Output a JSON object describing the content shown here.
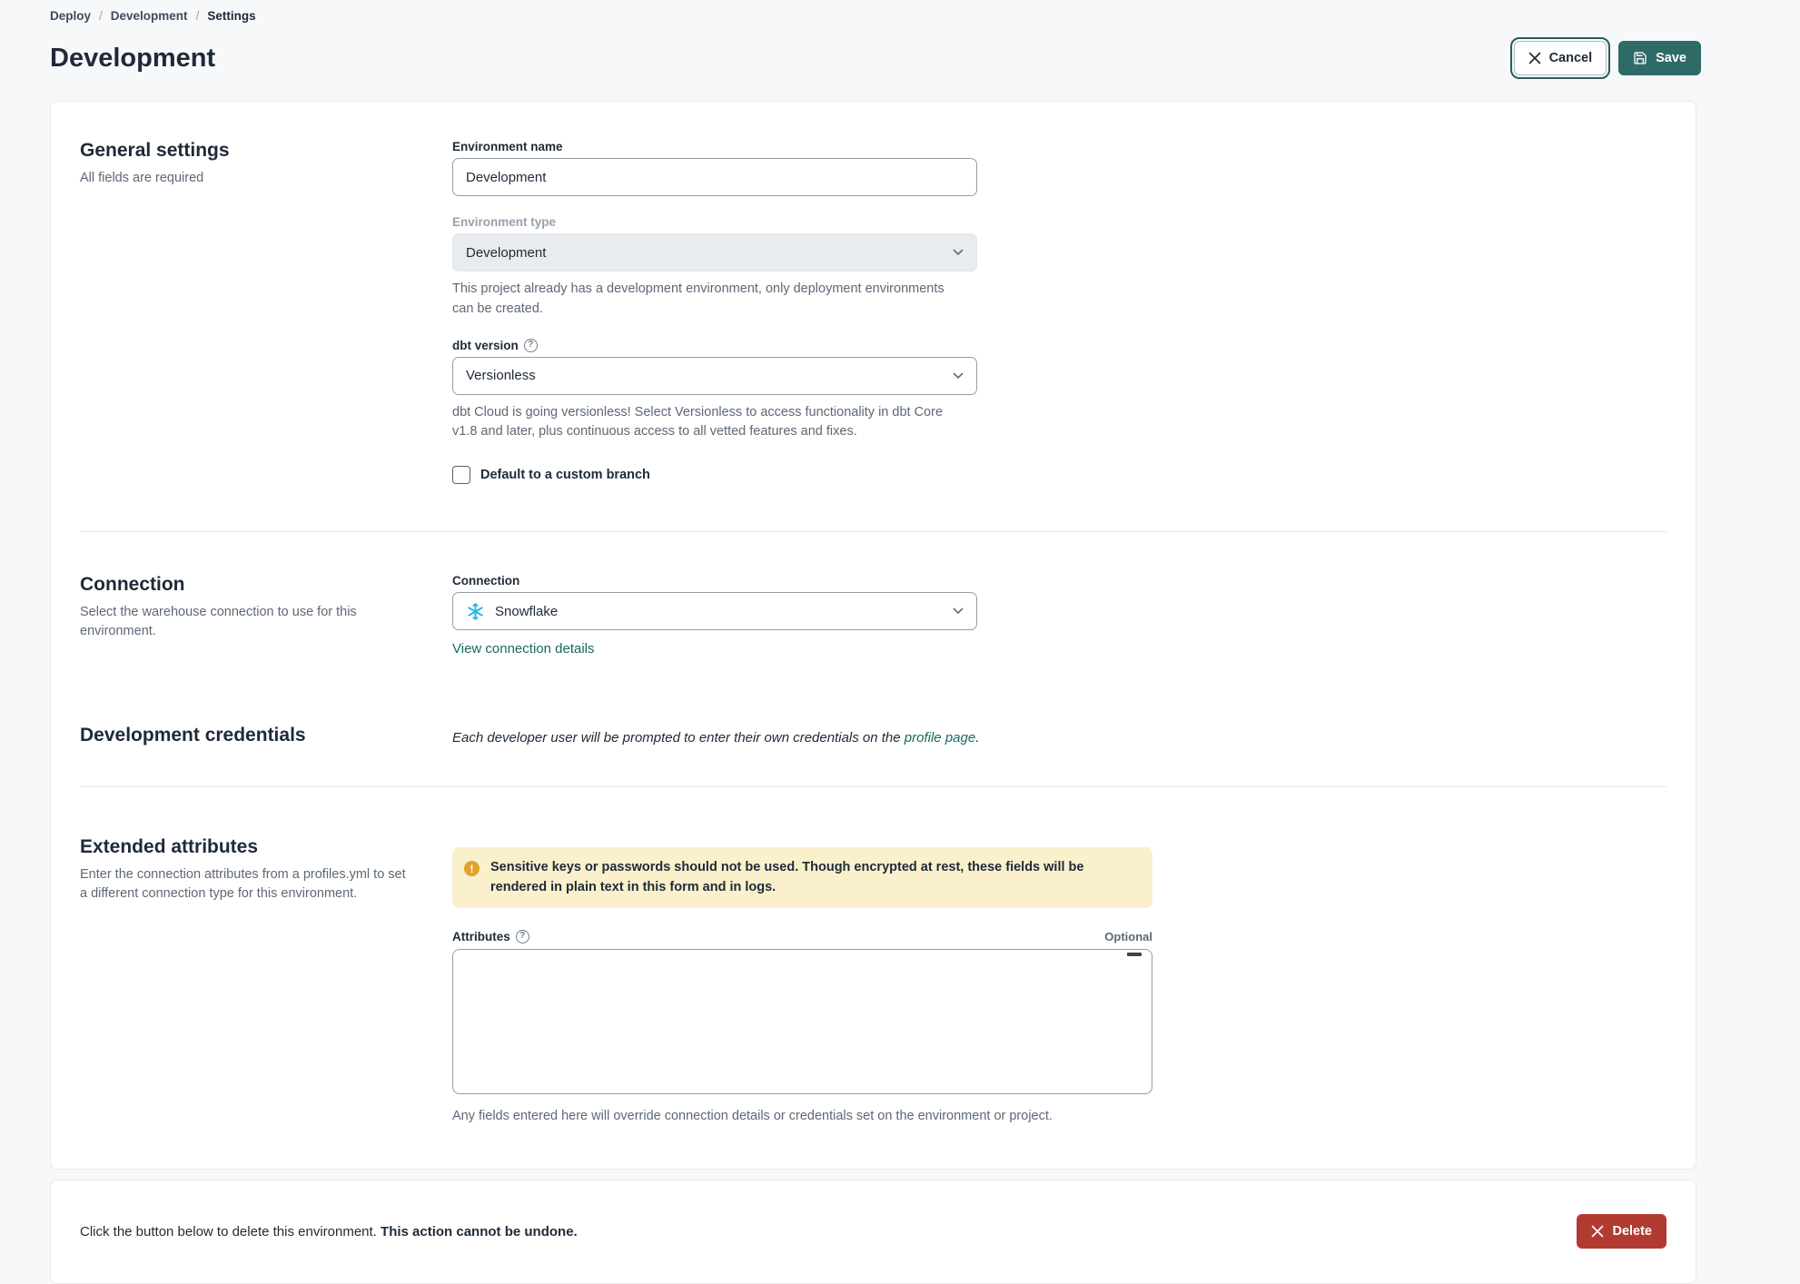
{
  "breadcrumb": {
    "separator": "/",
    "items": [
      "Deploy",
      "Development",
      "Settings"
    ]
  },
  "header": {
    "title": "Development",
    "cancel_label": "Cancel",
    "save_label": "Save"
  },
  "general": {
    "heading": "General settings",
    "subheading": "All fields are required",
    "env_name": {
      "label": "Environment name",
      "value": "Development"
    },
    "env_type": {
      "label": "Environment type",
      "value": "Development",
      "help": "This project already has a development environment, only deployment environments can be created."
    },
    "dbt_version": {
      "label": "dbt version",
      "value": "Versionless",
      "help": "dbt Cloud is going versionless! Select Versionless to access functionality in dbt Core v1.8 and later, plus continuous access to all vetted features and fixes."
    },
    "custom_branch": {
      "label": "Default to a custom branch",
      "checked": false
    }
  },
  "connection": {
    "heading": "Connection",
    "subheading": "Select the warehouse connection to use for this environment.",
    "field_label": "Connection",
    "value": "Snowflake",
    "link_label": "View connection details"
  },
  "credentials": {
    "heading": "Development credentials",
    "note_prefix": "Each developer user will be prompted to enter their own credentials on the ",
    "note_link": "profile page",
    "note_suffix": "."
  },
  "extended": {
    "heading": "Extended attributes",
    "subheading": "Enter the connection attributes from a profiles.yml to set a different connection type for this environment.",
    "warning_text": "Sensitive keys or passwords should not be used. Though encrypted at rest, these fields will be rendered in plain text in this form and in logs.",
    "attributes_label": "Attributes",
    "optional_label": "Optional",
    "textarea_value": "",
    "help_text": "Any fields entered here will override connection details or credentials set on the environment or project."
  },
  "danger": {
    "text_prefix": "Click the button below to delete this environment. ",
    "text_bold": "This action cannot be undone.",
    "delete_label": "Delete"
  },
  "icons": {
    "help_glyph": "?",
    "warning_glyph": "!"
  },
  "colors": {
    "accent_teal": "#2d6a68",
    "link_teal": "#17695f",
    "danger_red": "#b23b31",
    "warning_bg": "#faf0cc",
    "snowflake_blue": "#29b5e8",
    "page_bg": "#f7f8fa"
  }
}
